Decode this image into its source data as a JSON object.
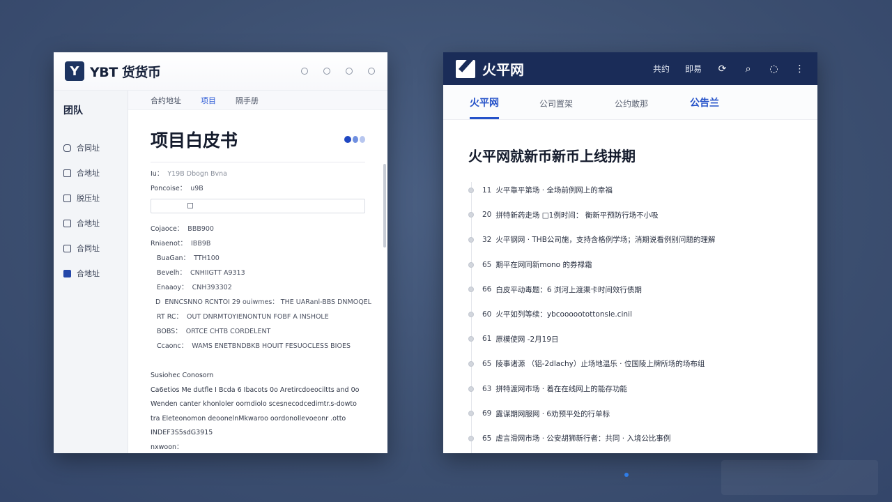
{
  "left_window": {
    "brand": "YBT 货货币",
    "logo_glyph": "Y",
    "window_controls": [
      "circle",
      "circle",
      "circle",
      "circle"
    ],
    "sidebar": {
      "title": "团队",
      "items": [
        {
          "label": "合同址",
          "icon": "chat-icon"
        },
        {
          "label": "合地址",
          "icon": "document-icon"
        },
        {
          "label": "脱压址",
          "icon": "home-icon"
        },
        {
          "label": "合地址",
          "icon": "file-icon"
        },
        {
          "label": "合同址",
          "icon": "lock-icon"
        },
        {
          "label": "合地址",
          "icon": "square-icon"
        }
      ]
    },
    "tabs": [
      {
        "label": "合约地址",
        "active": false
      },
      {
        "label": "项目",
        "active": true
      },
      {
        "label": "隔手册",
        "active": false
      }
    ],
    "title": "项目白皮书",
    "fields_top": [
      {
        "key": "Iu：",
        "value": "Y19B   Dbogn Bvna",
        "dim": true
      },
      {
        "key": "Poncoise：",
        "value": "u9B",
        "dim": false
      }
    ],
    "fields": [
      {
        "key": "Cojaoce：",
        "value": "BBB900",
        "indent": false
      },
      {
        "key": "Rniaenot：",
        "value": "IBB9B",
        "indent": false
      },
      {
        "key": "BuaGan：",
        "value": "TTH100",
        "indent": true
      },
      {
        "key": "Bevelh：",
        "value": "CNHIIGTT A9313",
        "indent": true
      },
      {
        "key": "Enaaoy：",
        "value": "CNH393302",
        "indent": true
      },
      {
        "key": "D",
        "value": "ENNCSNNO RCNTOI 29 ouiwmes：  THE UARanl-BBS DNMOQEL",
        "indent": true
      },
      {
        "key": "RT RC：",
        "value": "OUT DNRMTOYIENONTUN FOBF A INSHOLE",
        "indent": true
      },
      {
        "key": "BOBS：",
        "value": "ORTCE CHTB CORDELENT",
        "indent": true
      },
      {
        "key": "Ccaonc：",
        "value": "WAMS ENETBNDBKB HOUIT FESUOCLESS BIOES",
        "indent": true
      }
    ],
    "paragraph": {
      "title": "Susiohec Conosorn",
      "lines": [
        "Ca6etios Me dutfle I Bcda 6 Ibacots 0o Aretircdoeociltts and 0o",
        "Wenden  canter  khonloler oorndiolo scesnecodcedimtr.s-dowto",
        "tra Eleteonomon  deoonelnMkwaroo  oordonollevoeonr .otto",
        "INDEF3S5sdG3915",
        "nxwoon："
      ]
    }
  },
  "right_window": {
    "brand": "火平网",
    "actions": [
      {
        "type": "text",
        "label": "共约"
      },
      {
        "type": "text",
        "label": "即易"
      },
      {
        "type": "icon",
        "icon": "refresh-icon",
        "glyph": "⟳"
      },
      {
        "type": "icon",
        "icon": "search-icon",
        "glyph": "⌕"
      },
      {
        "type": "icon",
        "icon": "chat-icon",
        "glyph": "◌"
      },
      {
        "type": "icon",
        "icon": "more-vertical-icon",
        "glyph": "⋮"
      }
    ],
    "tabs": [
      {
        "label": "火平网",
        "style": "active"
      },
      {
        "label": "公司置架",
        "style": "normal"
      },
      {
        "label": "公约敢那",
        "style": "normal"
      },
      {
        "label": "公告兰",
        "style": "bold"
      }
    ],
    "title": "火平网就新币新币上线拼期",
    "items": [
      {
        "num": "11",
        "text": "火平靠平第场 · 全场前例网上的幸福"
      },
      {
        "num": "20",
        "text": "拼特新药走场 □1例时间：  衡新平预防行场不小吸"
      },
      {
        "num": "32",
        "text": "火平钢网 · THB公司施，支持含格例学场；消期说看例别问题的理解"
      },
      {
        "num": "65",
        "text": "期平在网同新mono 的券禄霜"
      },
      {
        "num": "66",
        "text": "白皮平动毒题：6 浏河上渡渠卡时间效行债期"
      },
      {
        "num": "60",
        "text": "火平如列等续：ybcoooootottonsle.cinil"
      },
      {
        "num": "61",
        "text": "原模使网 -2月19日"
      },
      {
        "num": "65",
        "text": "陵事诸源 （铝-2dlachy）止场地温乐 · 位国陵上牌所场的场布组"
      },
      {
        "num": "63",
        "text": "拼特渡网市场 · 着在在线网上的能存功能"
      },
      {
        "num": "69",
        "text": "露谋期网服网 · 6劝预平处的行单标"
      },
      {
        "num": "65",
        "text": "虐言滑网市场 · 公安胡狮新行者：共同 · 入境公比事例"
      }
    ]
  },
  "colors": {
    "background": "#3f5273",
    "right_header": "#1a2c58",
    "accent_blue": "#2552c9",
    "left_logo": "#1d3461"
  }
}
